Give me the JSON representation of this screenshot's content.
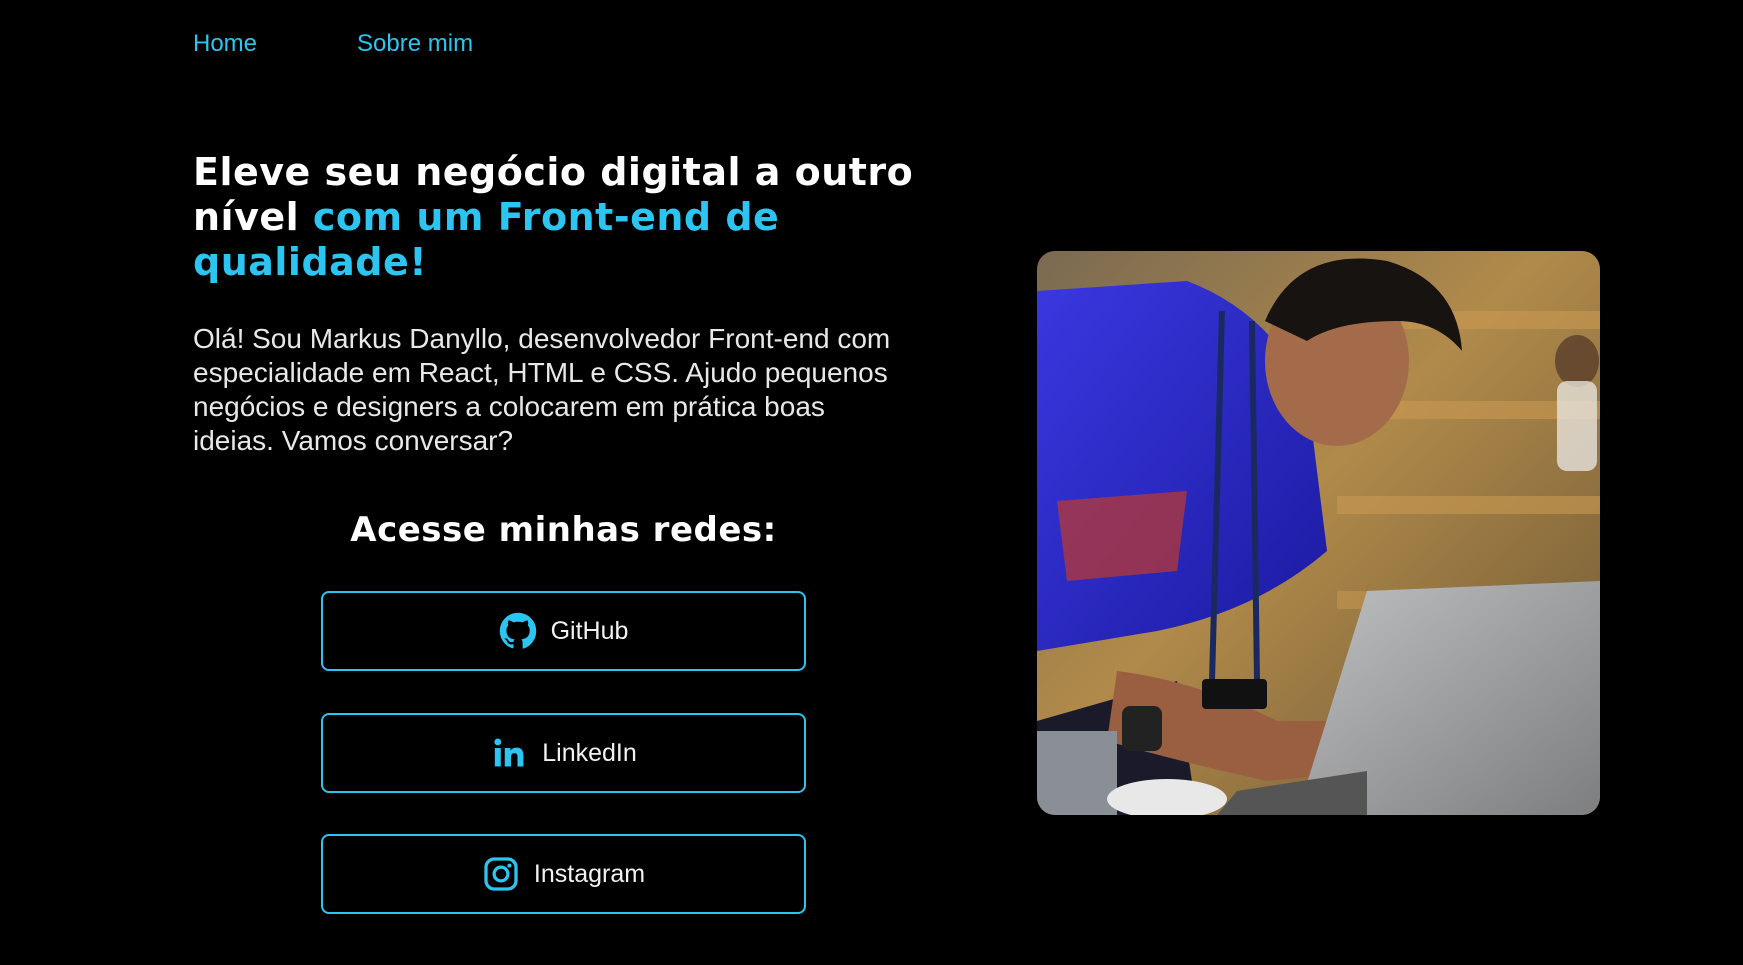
{
  "nav": {
    "items": [
      "Home",
      "Sobre mim"
    ]
  },
  "hero": {
    "headline_plain": "Eleve seu negócio digital a outro nível ",
    "headline_accent": "com um Front-end de qualidade!",
    "intro": "Olá! Sou Markus Danyllo, desenvolvedor Front-end com especialidade em React, HTML e CSS. Ajudo pequenos negócios e designers a colocarem em prática boas ideias. Vamos conversar?"
  },
  "social": {
    "title": "Acesse minhas redes:",
    "buttons": [
      {
        "label": "GitHub",
        "icon": "github-icon"
      },
      {
        "label": "LinkedIn",
        "icon": "linkedin-icon"
      },
      {
        "label": "Instagram",
        "icon": "instagram-icon"
      }
    ]
  },
  "colors": {
    "background": "#000000",
    "accent": "#2cc4f0",
    "text": "#ffffff"
  }
}
